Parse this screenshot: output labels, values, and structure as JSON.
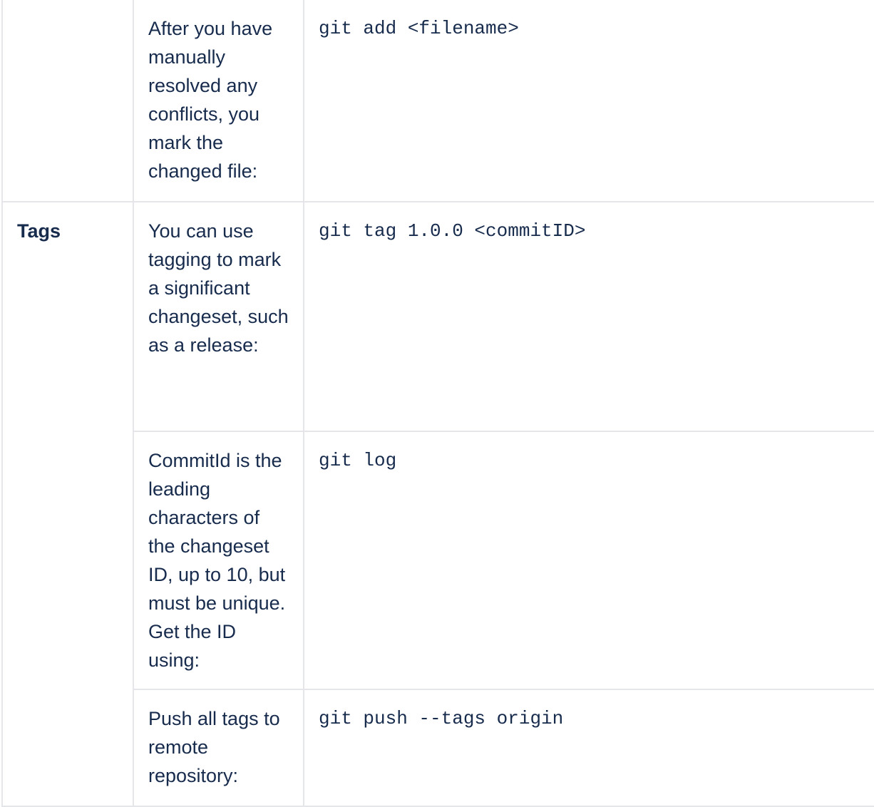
{
  "rows": [
    {
      "topic": "",
      "description": "After you have manually resolved any conflicts, you mark the changed file:",
      "command": "git add <filename>"
    },
    {
      "topic": "Tags",
      "description": "You can use tagging to mark a significant changeset, such as a release:",
      "command": "git tag 1.0.0 <commitID>"
    },
    {
      "topic": "",
      "description": "CommitId is the leading characters of the changeset ID, up to 10, but must be unique. Get the ID using:",
      "command": "git log"
    },
    {
      "topic": "",
      "description": "Push all tags to remote repository:",
      "command": "git push --tags origin"
    }
  ]
}
